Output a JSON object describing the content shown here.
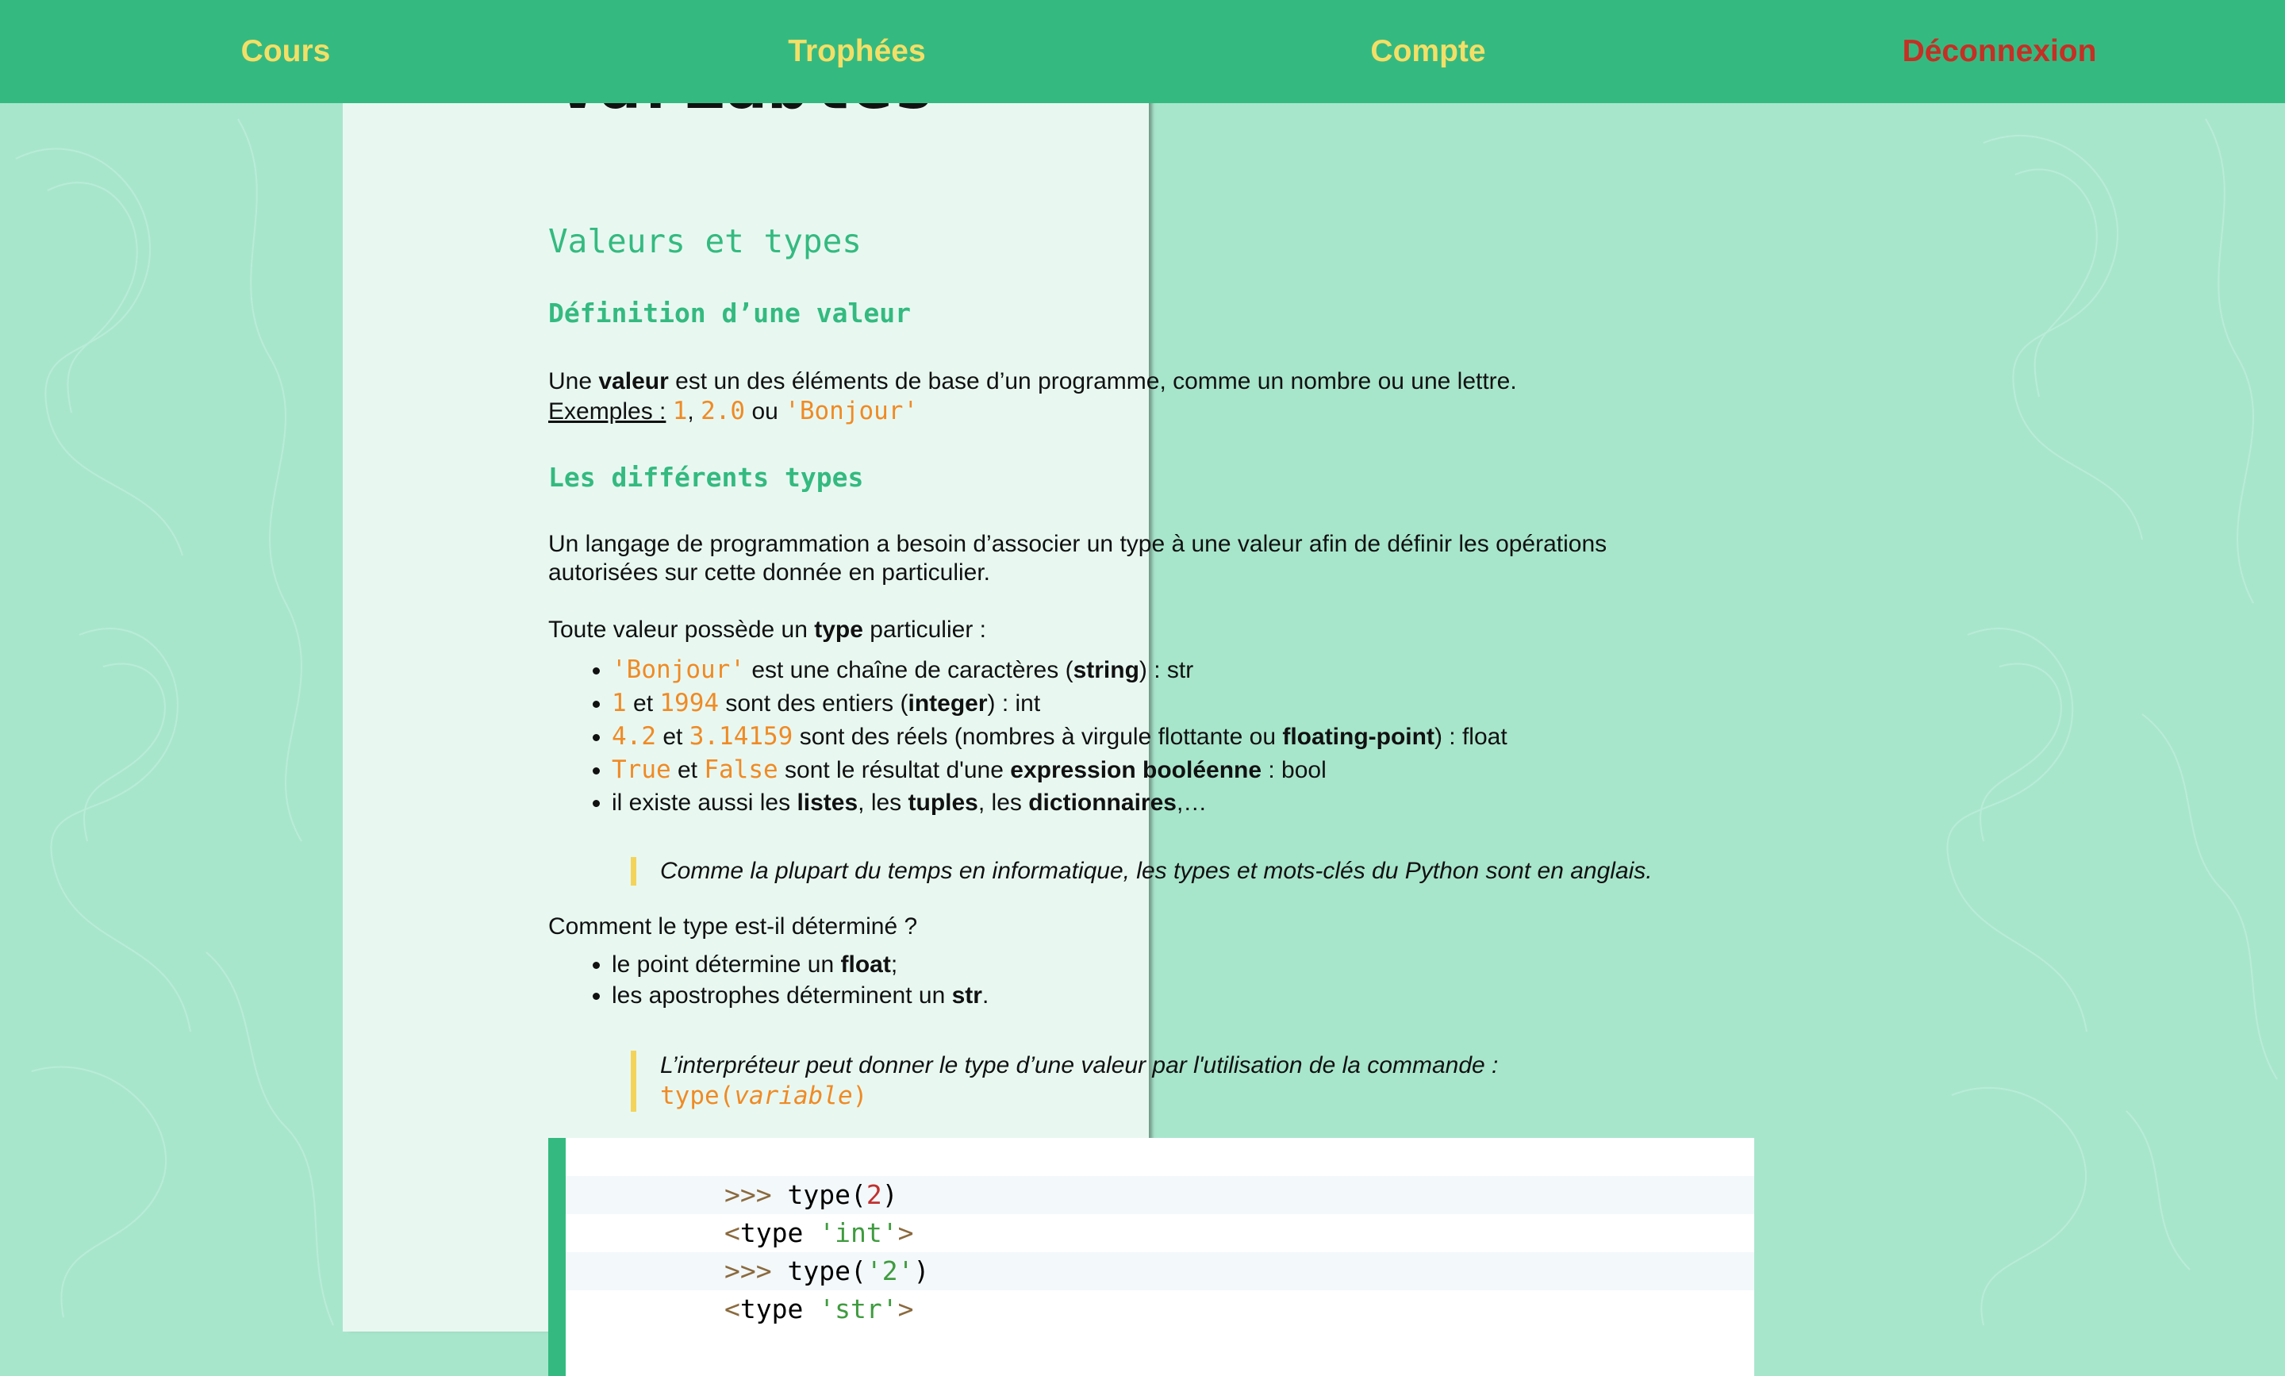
{
  "nav": {
    "cours": "Cours",
    "trophees": "Trophées",
    "compte": "Compte",
    "deconnexion": "Déconnexion"
  },
  "page": {
    "title": "Variables"
  },
  "section": {
    "h2": "Valeurs et types",
    "def_h3": "Définition d’une valeur",
    "def_p1_pre": "Une ",
    "def_p1_bold": "valeur",
    "def_p1_post": " est un des éléments de base d’un programme, comme un nombre ou une lettre.",
    "examples_label": "Exemples :",
    "ex1": "1",
    "ex_sep": ",",
    "ex2": "2.0",
    "ex_ou": "ou",
    "ex3": "'Bonjour'",
    "types_h3": "Les différents types",
    "types_p1_line1": "Un langage de programmation a besoin d’associer un type à une valeur afin de définir les opérations",
    "types_p1_line2": "autorisées sur cette donnée en particulier.",
    "types_p2_pre": "Toute valeur possède un ",
    "types_p2_bold": "type",
    "types_p2_post": " particulier :",
    "li1_code": "'Bonjour'",
    "li1_mid": " est une chaîne de caractères (",
    "li1_bold": "string",
    "li1_post": ") : str",
    "li2_code1": "1",
    "li2_et": " et ",
    "li2_code2": "1994",
    "li2_mid": " sont des entiers (",
    "li2_bold": "integer",
    "li2_post": ") : int",
    "li3_code1": "4.2",
    "li3_et": " et ",
    "li3_code2": "3.14159",
    "li3_mid": " sont des réels (nombres à virgule flottante ou ",
    "li3_bold": "floating-point",
    "li3_post": ") : float",
    "li4_code1": "True",
    "li4_et": " et ",
    "li4_code2": "False",
    "li4_mid": " sont le résultat d'une ",
    "li4_bold": "expression booléenne",
    "li4_post": " : bool",
    "li5_pre": "il existe aussi les ",
    "li5_b1": "listes",
    "li5_s1": ", les ",
    "li5_b2": "tuples",
    "li5_s2": ", les ",
    "li5_b3": "dictionnaires",
    "li5_post": ",…",
    "quote1": "Comme la plupart du temps en informatique, les types et mots-clés du Python sont en anglais.",
    "det_p": "Comment le type est-il déterminé ?",
    "det_li1_pre": "le point détermine un ",
    "det_li1_bold": "float",
    "det_li1_post": ";",
    "det_li2_pre": "les apostrophes déterminent un ",
    "det_li2_bold": "str",
    "det_li2_post": ".",
    "quote2_line1": "L’interpréteur peut donner le type d’une valeur par l'utilisation de la commande :",
    "quote2_code_pre": "type(",
    "quote2_code_var": "variable",
    "quote2_code_post": ")"
  },
  "codeblock": {
    "l1_prompt": ">>>",
    "l1_fn": " type(",
    "l1_arg": "2",
    "l1_close": ")",
    "l2_open": "<",
    "l2_kw": "type ",
    "l2_str": "'int'",
    "l2_close": ">",
    "l3_prompt": ">>>",
    "l3_fn": " type(",
    "l3_arg": "'2'",
    "l3_close": ")",
    "l4_open": "<",
    "l4_kw": "type ",
    "l4_str": "'str'",
    "l4_close": ">"
  },
  "colors": {
    "accent": "#34ba80",
    "nav_text": "#f3df67",
    "logout": "#c52f24",
    "code_orange": "#f08a24",
    "quote_bar": "#f4d35a",
    "page_bg": "#e8f8f1",
    "body_bg": "#a8e6cc"
  }
}
